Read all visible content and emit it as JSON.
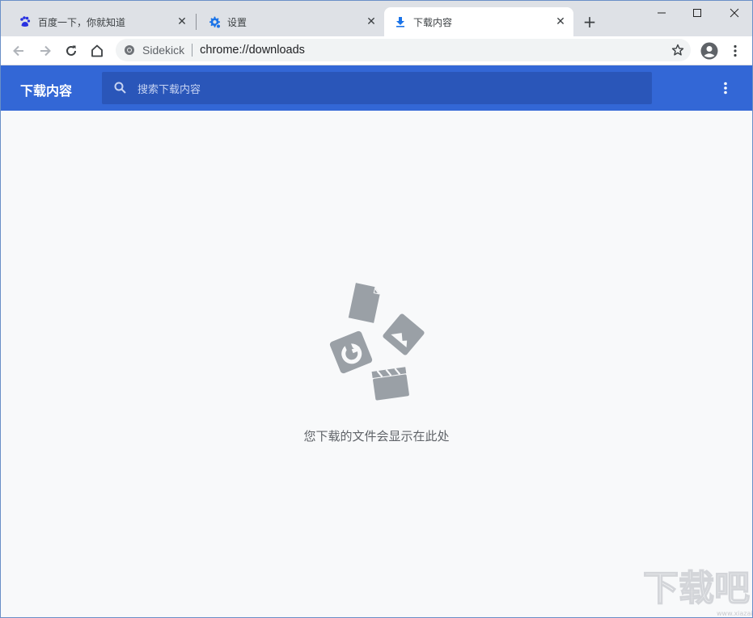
{
  "tabs": [
    {
      "title": "百度一下，你就知道",
      "icon": "baidu-paw-icon"
    },
    {
      "title": "设置",
      "icon": "gear-icon"
    },
    {
      "title": "下载内容",
      "icon": "download-icon",
      "active": true
    }
  ],
  "new_tab_label": "+",
  "toolbar": {
    "chip": "Sidekick",
    "url": "chrome://downloads"
  },
  "downloads": {
    "title": "下载内容",
    "search_placeholder": "搜索下载内容",
    "empty_message": "您下载的文件会显示在此处"
  },
  "watermark": {
    "text": "下载吧",
    "url": "www.xiazaiba.com"
  },
  "colors": {
    "header": "#3367d6",
    "search": "#2a56b9",
    "page_bg": "#f8f9fa",
    "tabstrip": "#dee1e6",
    "art": "#9aa0a6"
  }
}
